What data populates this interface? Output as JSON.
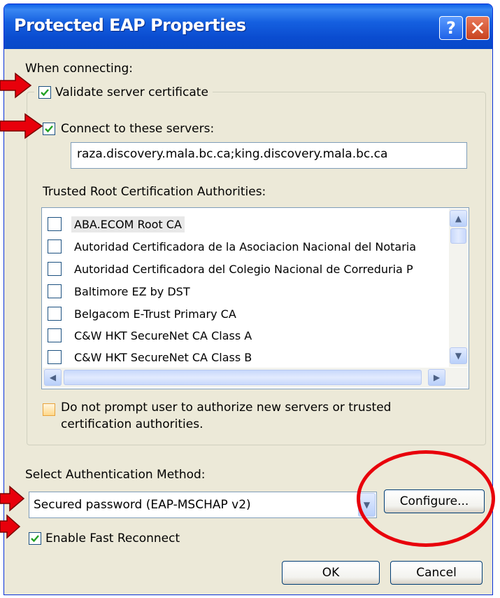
{
  "window": {
    "title": "Protected EAP Properties",
    "help_glyph": "?",
    "close_glyph": "✕"
  },
  "when_connecting_label": "When connecting:",
  "validate_cert": {
    "label": "Validate server certificate",
    "checked": true
  },
  "connect_servers": {
    "label": "Connect to these servers:",
    "checked": true,
    "value": "raza.discovery.mala.bc.ca;king.discovery.mala.bc.ca"
  },
  "trusted_root": {
    "label": "Trusted Root Certification Authorities:",
    "items": [
      {
        "label": "ABA.ECOM Root CA",
        "checked": false
      },
      {
        "label": "Autoridad Certificadora de la Asociacion Nacional del Notaria",
        "checked": false
      },
      {
        "label": "Autoridad Certificadora del Colegio Nacional de Correduria P",
        "checked": false
      },
      {
        "label": "Baltimore EZ by DST",
        "checked": false
      },
      {
        "label": "Belgacom E-Trust Primary CA",
        "checked": false
      },
      {
        "label": "C&W HKT SecureNet CA Class A",
        "checked": false
      },
      {
        "label": "C&W HKT SecureNet CA Class B",
        "checked": false
      }
    ]
  },
  "do_not_prompt": {
    "line1": "Do not prompt user to authorize new servers or trusted",
    "line2": "certification authorities.",
    "checked": false
  },
  "auth_method": {
    "label": "Select Authentication Method:",
    "value": "Secured password (EAP-MSCHAP v2)"
  },
  "configure_button": "Configure...",
  "fast_reconnect": {
    "label": "Enable Fast Reconnect",
    "checked": true
  },
  "ok_button": "OK",
  "cancel_button": "Cancel",
  "colors": {
    "titlebar": "#0A4CD0",
    "dialog_bg": "#ECE9D8",
    "annotation": "#E8000B",
    "checkmark": "#21A121"
  }
}
